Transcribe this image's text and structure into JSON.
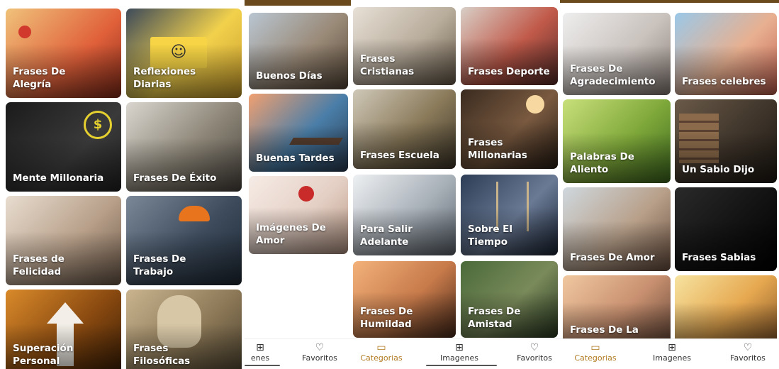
{
  "screen1": {
    "tiles": [
      {
        "label": "Frases De\nAlegría"
      },
      {
        "label": "Reflexiones\nDiarias"
      },
      {
        "label": "Mente Millonaria"
      },
      {
        "label": "Frases De Éxito"
      },
      {
        "label": "Frases de\nFelicidad"
      },
      {
        "label": "Frases De\nTrabajo"
      },
      {
        "label": "Superación\nPersonal"
      },
      {
        "label": "Frases\nFilosóficas"
      }
    ]
  },
  "screen2": {
    "tiles": [
      {
        "label": "Buenos Días"
      },
      {
        "label": "Buenas Tardes"
      },
      {
        "label": "Imágenes De\nAmor"
      }
    ],
    "nav": {
      "imagenes_partial": "enes",
      "favoritos": "Favoritos"
    }
  },
  "screen3": {
    "tiles": [
      {
        "label": "Frases\nCristianas"
      },
      {
        "label": "Frases Deporte"
      },
      {
        "label": "Frases Escuela"
      },
      {
        "label": "Frases\nMillonarias"
      },
      {
        "label": "Para Salir\nAdelante"
      },
      {
        "label": "Sobre El Tiempo"
      },
      {
        "label": "Frases De\nHumildad"
      },
      {
        "label": "Frases De\nAmistad"
      }
    ],
    "nav": {
      "categorias": "Categorias",
      "imagenes": "Imagenes",
      "favoritos": "Favoritos"
    }
  },
  "screen4": {
    "tiles": [
      {
        "label": "Frases De\nAgradecimiento"
      },
      {
        "label": "Frases celebres"
      },
      {
        "label": "Palabras De\nAliento"
      },
      {
        "label": "Un Sabio Dijo"
      },
      {
        "label": "Frases De Amor"
      },
      {
        "label": "Frases Sabias"
      },
      {
        "label": "Frases De La"
      },
      {
        "label": ""
      }
    ],
    "nav": {
      "categorias": "Categorias",
      "imagenes": "Imagenes",
      "favoritos": "Favoritos"
    }
  },
  "icons": {
    "categorias": "grid-square-icon",
    "imagenes": "image-grid-icon",
    "favoritos": "heart-icon"
  },
  "colors": {
    "accent": "#b07a1f",
    "topbar": "#6b4a1e",
    "text": "#333333"
  }
}
